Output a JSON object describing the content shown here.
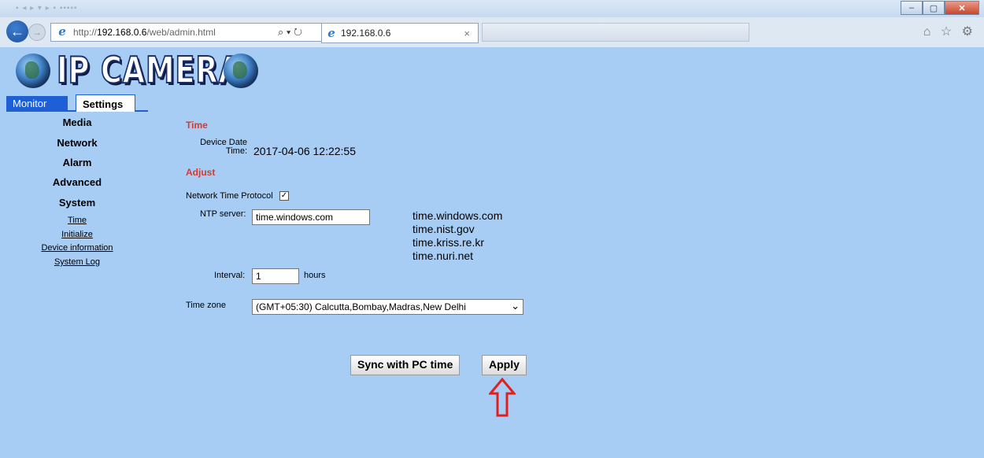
{
  "browser": {
    "url_prefix": "http://",
    "url_host": "192.168.0.6",
    "url_path": "/web/admin.html",
    "address_tools": "⌕ ▾ ↻",
    "tab_title": "192.168.0.6",
    "tab_close": "×",
    "window_buttons": {
      "minimize": "–",
      "maximize": "▢",
      "close": "✕"
    },
    "right_icons": "⌂ ☆ ⚙"
  },
  "header": {
    "logo_text": "IP CAMERA"
  },
  "sidebar": {
    "tabs": {
      "monitor": "Monitor",
      "settings": "Settings"
    },
    "menu": [
      "Media",
      "Network",
      "Alarm",
      "Advanced",
      "System"
    ],
    "submenu": [
      "Time",
      "Initialize",
      "Device information",
      "System Log"
    ]
  },
  "main": {
    "time_heading": "Time",
    "device_date_label_line1": "Device Date",
    "device_date_label_line2": "Time:",
    "device_datetime": "2017-04-06 12:22:55",
    "adjust_heading": "Adjust",
    "ntp_label": "Network Time Protocol",
    "ntp_checked": "✓",
    "ntp_server_label": "NTP server:",
    "ntp_server_value": "time.windows.com",
    "ntp_servers": [
      "time.windows.com",
      "time.nist.gov",
      "time.kriss.re.kr",
      "time.nuri.net"
    ],
    "interval_label": "Interval:",
    "interval_value": "1",
    "interval_unit": "hours",
    "timezone_label": "Time zone",
    "timezone_value": "(GMT+05:30) Calcutta,Bombay,Madras,New Delhi",
    "sync_button": "Sync with PC time",
    "apply_button": "Apply"
  },
  "colors": {
    "page_bg": "#a7cdf5",
    "heading_red": "#d8392a",
    "tab_blue": "#1e5fd6",
    "annotation_arrow": "#e02020"
  }
}
